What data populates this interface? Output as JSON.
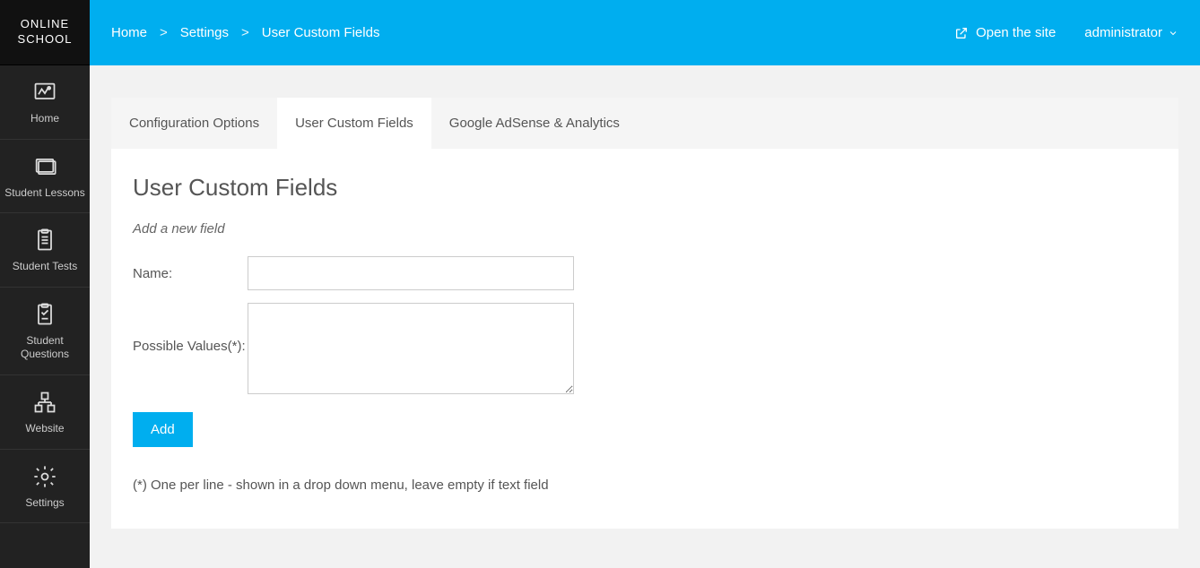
{
  "brand": "ONLINE SCHOOL",
  "sidebar": {
    "items": [
      {
        "label": "Home"
      },
      {
        "label": "Student Lessons"
      },
      {
        "label": "Student Tests"
      },
      {
        "label": "Student Questions"
      },
      {
        "label": "Website"
      },
      {
        "label": "Settings"
      }
    ]
  },
  "breadcrumb": {
    "items": [
      "Home",
      "Settings",
      "User Custom Fields"
    ],
    "sep": ">"
  },
  "topbar": {
    "open_site": "Open the site",
    "user": "administrator"
  },
  "tabs": [
    {
      "label": "Configuration Options",
      "active": false
    },
    {
      "label": "User Custom Fields",
      "active": true
    },
    {
      "label": "Google AdSense & Analytics",
      "active": false
    }
  ],
  "panel": {
    "title": "User Custom Fields",
    "subtitle": "Add a new field",
    "name_label": "Name:",
    "values_label": "Possible Values(*):",
    "name_value": "",
    "values_value": "",
    "add_button": "Add",
    "hint": "(*) One per line - shown in a drop down menu, leave empty if text field"
  }
}
